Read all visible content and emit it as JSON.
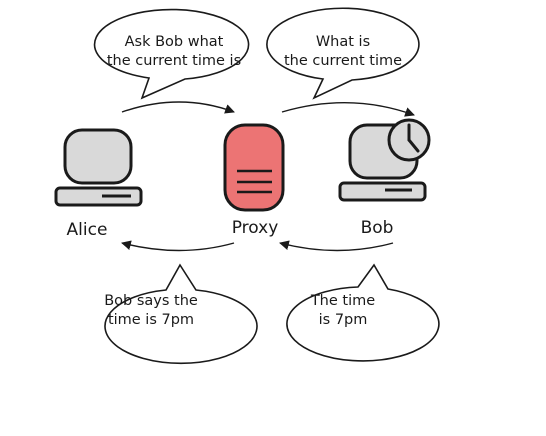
{
  "nodes": {
    "alice": "Alice",
    "proxy": "Proxy",
    "bob": "Bob"
  },
  "bubbles": {
    "alice_to_proxy": [
      "Ask Bob what",
      "the current time is"
    ],
    "proxy_to_bob": [
      "What is",
      "the current time"
    ],
    "proxy_to_alice": [
      "Bob says the",
      "time is 7pm"
    ],
    "bob_to_proxy": [
      "The time",
      "is 7pm"
    ]
  },
  "colors": {
    "proxy_fill": "#ec7474",
    "device_fill": "#d9d9d9",
    "stroke": "#1a1a1a"
  }
}
